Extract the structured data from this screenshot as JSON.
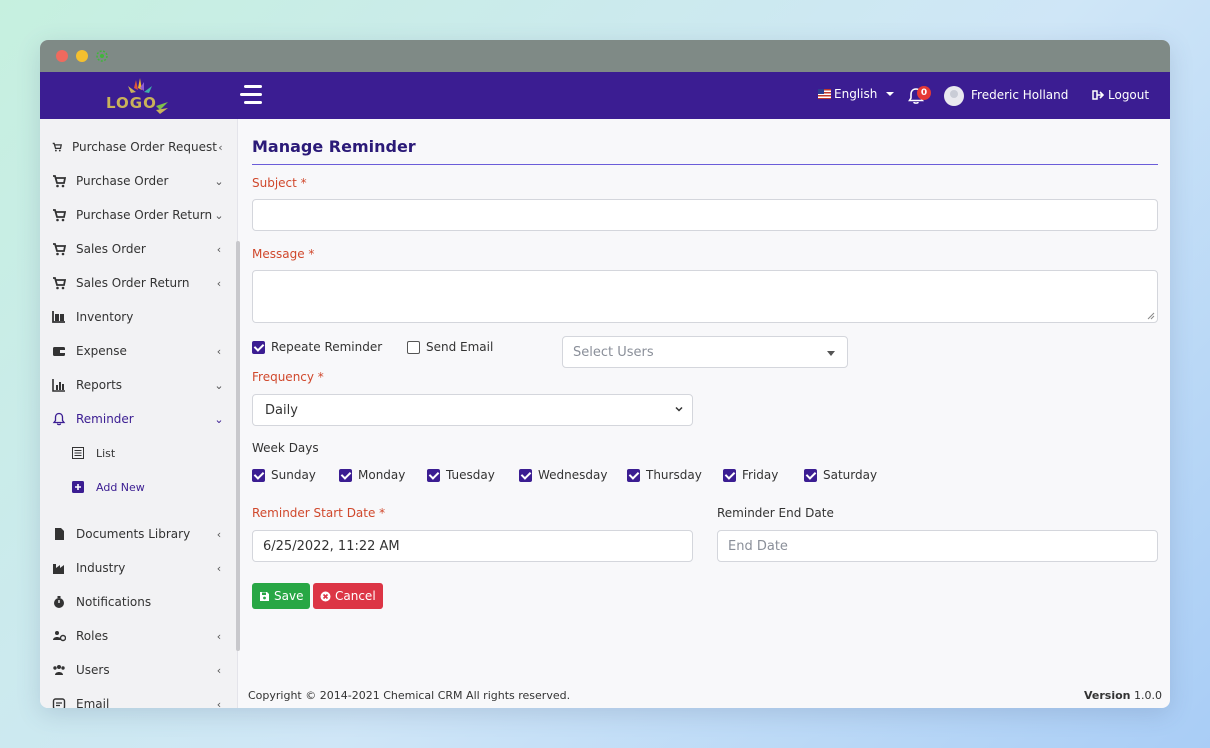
{
  "header": {
    "logo_text": "LOGO",
    "language": "English",
    "notification_count": "0",
    "user_name": "Frederic Holland",
    "logout_label": "Logout"
  },
  "sidebar": {
    "items": [
      {
        "label": "Purchase Order Request",
        "icon": "cart-icon",
        "chevron": "‹"
      },
      {
        "label": "Purchase Order",
        "icon": "cart-icon",
        "chevron": "⌄"
      },
      {
        "label": "Purchase Order Return",
        "icon": "cart-icon",
        "chevron": "⌄"
      },
      {
        "label": "Sales Order",
        "icon": "cart-icon",
        "chevron": "‹"
      },
      {
        "label": "Sales Order Return",
        "icon": "cart-icon",
        "chevron": "‹"
      },
      {
        "label": "Inventory",
        "icon": "inventory-icon",
        "chevron": ""
      },
      {
        "label": "Expense",
        "icon": "wallet-icon",
        "chevron": "‹"
      },
      {
        "label": "Reports",
        "icon": "bar-chart-icon",
        "chevron": "⌄"
      },
      {
        "label": "Reminder",
        "icon": "bell-icon",
        "chevron": "⌄"
      },
      {
        "label": "Documents Library",
        "icon": "document-icon",
        "chevron": "‹"
      },
      {
        "label": "Industry",
        "icon": "factory-icon",
        "chevron": "‹"
      },
      {
        "label": "Notifications",
        "icon": "stopwatch-icon",
        "chevron": ""
      },
      {
        "label": "Roles",
        "icon": "roles-icon",
        "chevron": "‹"
      },
      {
        "label": "Users",
        "icon": "users-icon",
        "chevron": "‹"
      },
      {
        "label": "Email",
        "icon": "email-icon",
        "chevron": "‹"
      }
    ],
    "sub_items": [
      {
        "label": "List",
        "icon": "list-icon"
      },
      {
        "label": "Add New",
        "icon": "plus-square-icon"
      }
    ]
  },
  "main": {
    "title": "Manage Reminder",
    "subject_label": "Subject *",
    "subject_value": "",
    "message_label": "Message *",
    "message_value": "",
    "repeat_reminder_label": "Repeate Reminder",
    "send_email_label": "Send Email",
    "select_users_placeholder": "Select Users",
    "frequency_label": "Frequency *",
    "frequency_value": "Daily",
    "week_days_label": "Week Days",
    "week_days": [
      "Sunday",
      "Monday",
      "Tuesday",
      "Wednesday",
      "Thursday",
      "Friday",
      "Saturday"
    ],
    "start_date_label": "Reminder Start Date *",
    "start_date_value": "6/25/2022, 11:22 AM",
    "end_date_label": "Reminder End Date",
    "end_date_placeholder": "End Date",
    "save_label": "Save",
    "cancel_label": "Cancel"
  },
  "footer": {
    "copyright": "Copyright © 2014-2021 Chemical CRM All rights reserved.",
    "version_label": "Version",
    "version_value": "1.0.0"
  },
  "colors": {
    "primary": "#3b1d92",
    "required_label": "#d0482c",
    "save": "#28a745",
    "cancel": "#dc3545"
  }
}
